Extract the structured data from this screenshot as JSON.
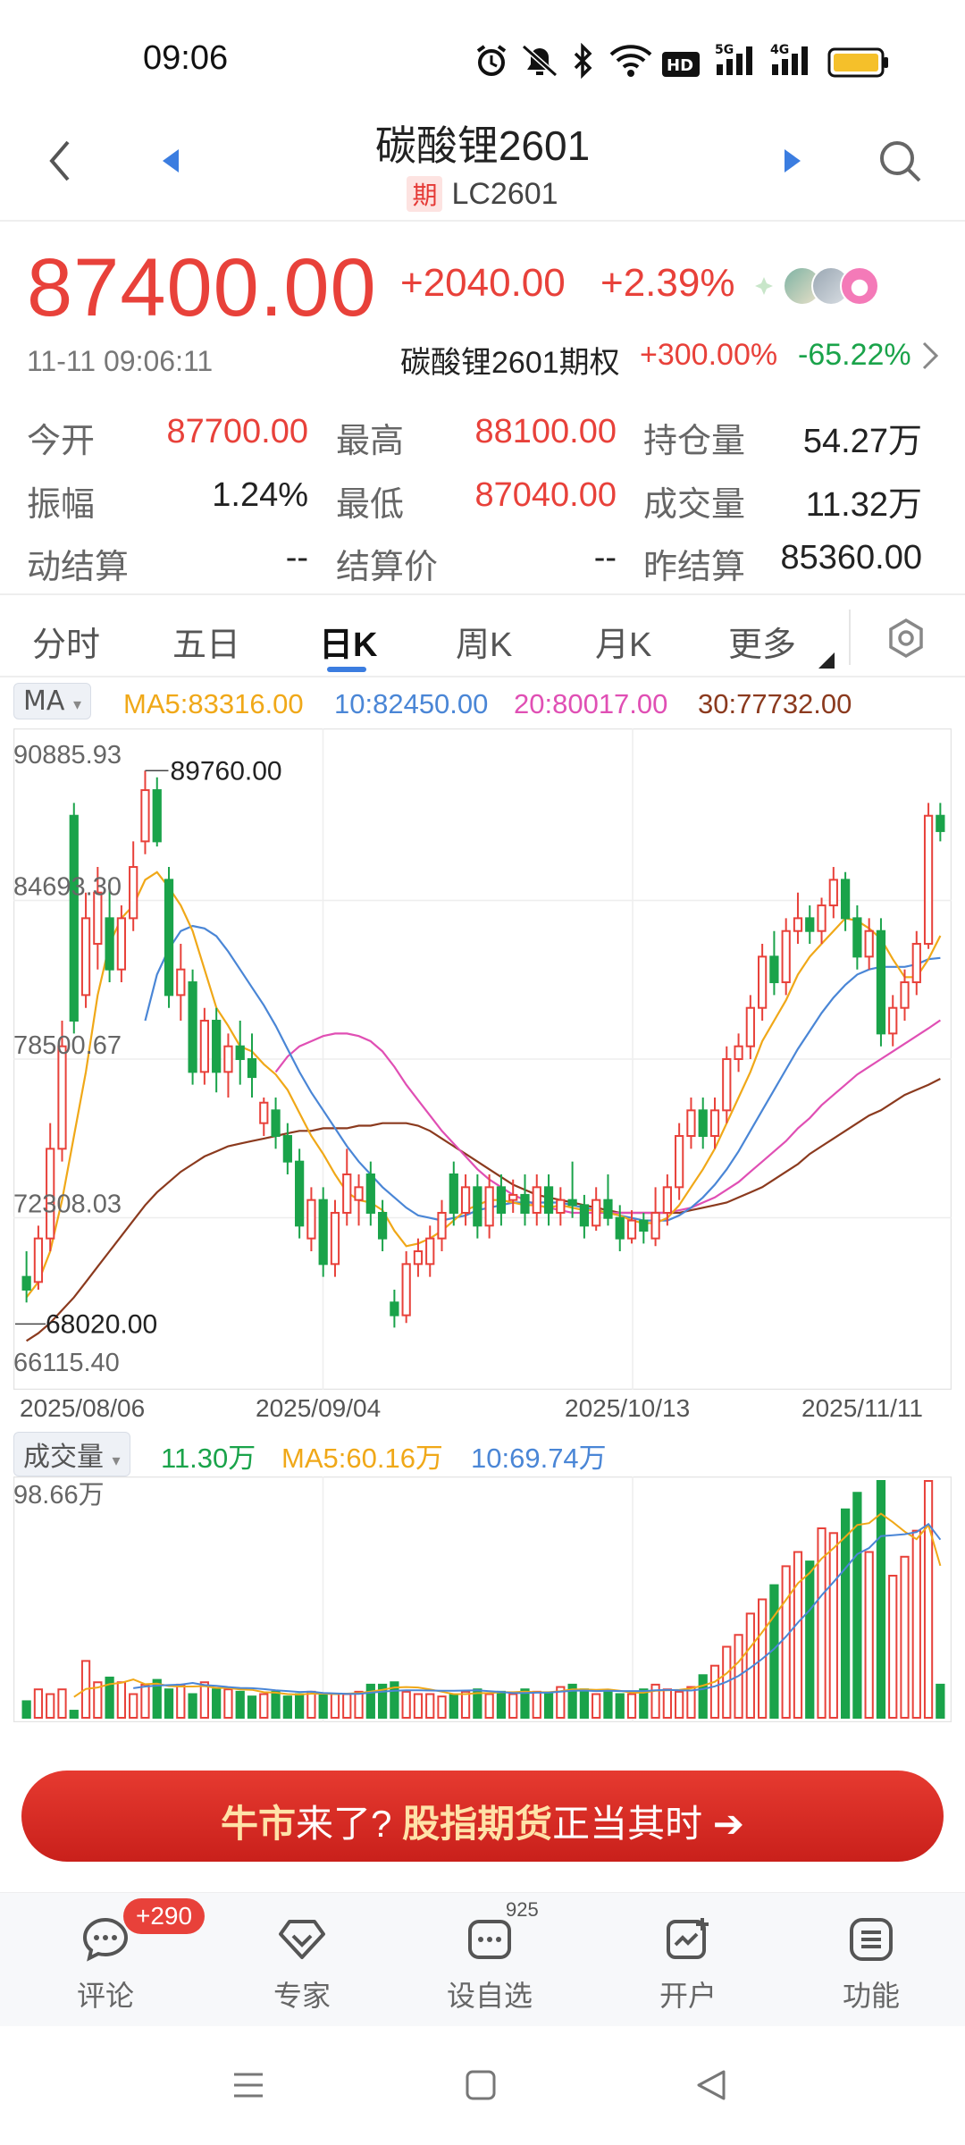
{
  "status": {
    "time": "09:06",
    "battery_color": "#f5c02a"
  },
  "header": {
    "title": "碳酸锂2601",
    "tag": "期",
    "code": "LC2601"
  },
  "quote": {
    "price": "87400.00",
    "change": "+2040.00",
    "change_pct": "+2.39%",
    "timestamp": "11-11 09:06:11",
    "option_name": "碳酸锂2601期权",
    "option_up": "+300.00%",
    "option_down": "-65.22%",
    "up_color": "#e8413a",
    "down_color": "#1aa34a"
  },
  "stats": [
    {
      "label": "今开",
      "value": "87700.00",
      "color": "red"
    },
    {
      "label": "最高",
      "value": "88100.00",
      "color": "red"
    },
    {
      "label": "持仓量",
      "value": "54.27万",
      "color": "black"
    },
    {
      "label": "振幅",
      "value": "1.24%",
      "color": "black"
    },
    {
      "label": "最低",
      "value": "87040.00",
      "color": "red"
    },
    {
      "label": "成交量",
      "value": "11.32万",
      "color": "black"
    },
    {
      "label": "动结算",
      "value": "--",
      "color": "black"
    },
    {
      "label": "结算价",
      "value": "--",
      "color": "black"
    },
    {
      "label": "昨结算",
      "value": "85360.00",
      "color": "black"
    }
  ],
  "tabs": [
    {
      "label": "分时",
      "active": false
    },
    {
      "label": "五日",
      "active": false
    },
    {
      "label": "日K",
      "active": true
    },
    {
      "label": "周K",
      "active": false
    },
    {
      "label": "月K",
      "active": false
    },
    {
      "label": "更多",
      "active": false
    }
  ],
  "ma_legend": {
    "selector": "MA",
    "ma5": "MA5:83316.00",
    "ma10": "10:82450.00",
    "ma20": "20:80017.00",
    "ma30": "30:77732.00",
    "colors": {
      "ma5": "#f0a818",
      "ma10": "#4a86d6",
      "ma20": "#e04fb4",
      "ma30": "#8b3a1e"
    }
  },
  "chart_data": {
    "type": "candlestick",
    "y_tick_labels": [
      "90885.93",
      "84693.30",
      "78500.67",
      "72308.03",
      "66115.40"
    ],
    "ylim": [
      66115.4,
      90885.93
    ],
    "x_tick_labels": [
      "2025/08/06",
      "2025/09/04",
      "2025/10/13",
      "2025/11/11"
    ],
    "annotations": [
      {
        "label": "89760.00",
        "kind": "high"
      },
      {
        "label": "68020.00",
        "kind": "low"
      }
    ],
    "candles": [
      [
        70000,
        69500,
        71000,
        69000
      ],
      [
        69800,
        71500,
        72000,
        69500
      ],
      [
        71500,
        75000,
        76000,
        71000
      ],
      [
        75000,
        79000,
        80000,
        74500
      ],
      [
        88000,
        80000,
        88500,
        79500
      ],
      [
        81000,
        84000,
        85000,
        80500
      ],
      [
        83000,
        85000,
        86000,
        82000
      ],
      [
        84000,
        82000,
        85500,
        81500
      ],
      [
        82000,
        84000,
        84500,
        81500
      ],
      [
        84000,
        86000,
        87000,
        83500
      ],
      [
        87000,
        89000,
        89760,
        86500
      ],
      [
        89000,
        87000,
        89500,
        86800
      ],
      [
        85500,
        81000,
        86000,
        80500
      ],
      [
        81000,
        82000,
        83000,
        80000
      ],
      [
        81500,
        78000,
        82000,
        77500
      ],
      [
        78000,
        80000,
        80500,
        77500
      ],
      [
        80000,
        78000,
        80500,
        77200
      ],
      [
        78000,
        79000,
        79500,
        77000
      ],
      [
        79000,
        78500,
        80000,
        77500
      ],
      [
        78500,
        77800,
        79500,
        77000
      ],
      [
        76000,
        76800,
        77000,
        75500
      ],
      [
        76500,
        75500,
        77000,
        75000
      ],
      [
        75500,
        74500,
        76000,
        74000
      ],
      [
        74500,
        72000,
        75000,
        71500
      ],
      [
        71500,
        73000,
        73500,
        71000
      ],
      [
        73000,
        70500,
        73500,
        70000
      ],
      [
        70500,
        72500,
        73000,
        70000
      ],
      [
        72500,
        74000,
        75000,
        72000
      ],
      [
        73000,
        73500,
        74000,
        72000
      ],
      [
        74000,
        72500,
        74500,
        72000
      ],
      [
        72500,
        71500,
        73000,
        71000
      ],
      [
        69000,
        68500,
        69500,
        68020
      ],
      [
        68500,
        70500,
        71000,
        68200
      ],
      [
        70500,
        71000,
        71500,
        70000
      ],
      [
        70500,
        71500,
        72000,
        70000
      ],
      [
        71500,
        72500,
        73000,
        71000
      ],
      [
        74000,
        72500,
        74500,
        72000
      ],
      [
        72500,
        73500,
        74000,
        72000
      ],
      [
        73500,
        72000,
        74000,
        71500
      ],
      [
        72000,
        73500,
        74000,
        71500
      ],
      [
        73500,
        72500,
        74000,
        72000
      ],
      [
        73000,
        73200,
        73800,
        72500
      ],
      [
        73200,
        72500,
        74000,
        72000
      ],
      [
        72500,
        73500,
        74000,
        72000
      ],
      [
        73500,
        72500,
        74000,
        72000
      ],
      [
        72500,
        73000,
        73500,
        72000
      ],
      [
        73000,
        72800,
        74500,
        72300
      ],
      [
        72800,
        72000,
        73200,
        71500
      ],
      [
        72000,
        73000,
        73500,
        71800
      ],
      [
        73000,
        72300,
        74000,
        72000
      ],
      [
        72300,
        71500,
        72800,
        71000
      ],
      [
        71500,
        72200,
        72600,
        71300
      ],
      [
        72200,
        71800,
        72500,
        71300
      ],
      [
        71500,
        72500,
        73500,
        71200
      ],
      [
        72500,
        73500,
        74000,
        72000
      ],
      [
        73500,
        75500,
        76000,
        73000
      ],
      [
        75500,
        76500,
        77000,
        75000
      ],
      [
        76500,
        75500,
        77000,
        75000
      ],
      [
        75500,
        76500,
        77000,
        75000
      ],
      [
        76500,
        78500,
        79000,
        76000
      ],
      [
        78500,
        79000,
        79500,
        78000
      ],
      [
        79000,
        80500,
        81000,
        78500
      ],
      [
        80500,
        82500,
        83000,
        80000
      ],
      [
        82500,
        81500,
        83500,
        81000
      ],
      [
        81500,
        83500,
        84000,
        81000
      ],
      [
        83500,
        84000,
        85000,
        83000
      ],
      [
        84000,
        83500,
        84500,
        83000
      ],
      [
        83500,
        84500,
        84800,
        83000
      ],
      [
        84500,
        85500,
        86000,
        84000
      ],
      [
        85500,
        84000,
        85800,
        83500
      ],
      [
        84000,
        82500,
        84500,
        82000
      ],
      [
        82500,
        83500,
        84000,
        82000
      ],
      [
        83500,
        79500,
        84000,
        79000
      ],
      [
        79500,
        80500,
        81000,
        79000
      ],
      [
        80500,
        81500,
        82000,
        80000
      ],
      [
        81500,
        83000,
        83500,
        81000
      ],
      [
        83000,
        88000,
        88500,
        82800
      ],
      [
        88000,
        87400,
        88500,
        87000
      ]
    ],
    "ma5": [
      69200,
      69800,
      71000,
      73000,
      75500,
      78000,
      81000,
      83000,
      84000,
      84500,
      85500,
      85800,
      85200,
      84500,
      83500,
      82000,
      80500,
      79800,
      79000,
      78800,
      78300,
      77900,
      77300,
      76400,
      75500,
      74800,
      74000,
      73300,
      73000,
      72900,
      72600,
      71800,
      71200,
      71300,
      71500,
      71800,
      72200,
      72600,
      72800,
      73000,
      73000,
      72900,
      72800,
      72800,
      72700,
      72800,
      72700,
      72600,
      72600,
      72500,
      72400,
      72200,
      72100,
      72100,
      72300,
      72800,
      73500,
      74200,
      75000,
      76000,
      77000,
      78000,
      79200,
      80000,
      80800,
      81800,
      82500,
      83000,
      83500,
      84000,
      83900,
      83600,
      83200,
      82400,
      81700,
      81700,
      82400,
      83316
    ],
    "ma10": [
      null,
      null,
      null,
      null,
      null,
      null,
      null,
      null,
      null,
      null,
      80000,
      81800,
      82800,
      83500,
      83700,
      83600,
      83300,
      82700,
      82000,
      81300,
      80600,
      79800,
      78900,
      78000,
      77200,
      76500,
      75800,
      75100,
      74500,
      74000,
      73500,
      73100,
      72700,
      72400,
      72300,
      72200,
      72300,
      72400,
      72600,
      72700,
      72800,
      72900,
      72900,
      72900,
      72900,
      72900,
      72800,
      72700,
      72600,
      72500,
      72400,
      72300,
      72200,
      72200,
      72200,
      72400,
      72700,
      73100,
      73600,
      74200,
      74900,
      75700,
      76500,
      77300,
      78100,
      78900,
      79600,
      80300,
      80900,
      81400,
      81800,
      82000,
      82100,
      82100,
      82100,
      82200,
      82400,
      82450
    ],
    "ma20": [
      null,
      null,
      null,
      null,
      null,
      null,
      null,
      null,
      null,
      null,
      null,
      null,
      null,
      null,
      null,
      null,
      null,
      null,
      null,
      null,
      null,
      78000,
      78600,
      79000,
      79200,
      79400,
      79500,
      79500,
      79400,
      79200,
      78800,
      78200,
      77500,
      76900,
      76300,
      75700,
      75200,
      74700,
      74200,
      73800,
      73500,
      73200,
      73000,
      72800,
      72700,
      72600,
      72500,
      72500,
      72500,
      72500,
      72500,
      72500,
      72500,
      72500,
      72500,
      72600,
      72700,
      72900,
      73100,
      73400,
      73700,
      74100,
      74500,
      74900,
      75300,
      75800,
      76200,
      76700,
      77100,
      77500,
      77900,
      78200,
      78500,
      78800,
      79100,
      79400,
      79700,
      80017
    ],
    "ma30": [
      67500,
      67800,
      68200,
      68700,
      69200,
      69800,
      70400,
      71000,
      71600,
      72200,
      72800,
      73300,
      73700,
      74100,
      74400,
      74700,
      74900,
      75100,
      75200,
      75300,
      75400,
      75500,
      75600,
      75700,
      75700,
      75800,
      75800,
      75800,
      75900,
      75900,
      76000,
      76000,
      76000,
      75900,
      75700,
      75400,
      75100,
      74800,
      74500,
      74200,
      73900,
      73600,
      73400,
      73200,
      73100,
      73000,
      72900,
      72800,
      72700,
      72600,
      72500,
      72500,
      72500,
      72500,
      72500,
      72500,
      72600,
      72700,
      72800,
      72900,
      73100,
      73300,
      73500,
      73800,
      74100,
      74400,
      74800,
      75100,
      75400,
      75700,
      76000,
      76300,
      76500,
      76800,
      77100,
      77300,
      77500,
      77732
    ]
  },
  "volume": {
    "selector": "成交量",
    "current": "11.30万",
    "ma5": "MA5:60.16万",
    "ma10": "10:69.74万",
    "max_label": "98.66万",
    "values": [
      7,
      12,
      10,
      12,
      3,
      24,
      15,
      17,
      15,
      10,
      14,
      16,
      12,
      14,
      10,
      15,
      12,
      12,
      11,
      9,
      10,
      11,
      9,
      10,
      11,
      10,
      10,
      10,
      11,
      14,
      14,
      15,
      11,
      10,
      10,
      9,
      10,
      11,
      12,
      10,
      11,
      10,
      12,
      11,
      10,
      13,
      14,
      12,
      10,
      11,
      10,
      10,
      12,
      14,
      12,
      11,
      13,
      18,
      22,
      30,
      35,
      44,
      50,
      56,
      64,
      70,
      66,
      80,
      78,
      88,
      95,
      70,
      100,
      60,
      68,
      79,
      100,
      14
    ]
  },
  "banner": {
    "part1": "牛市",
    "part2": "来了?",
    "part3": "股指期货",
    "part4": "正当其时",
    "arrow": "➔"
  },
  "toolbar": [
    {
      "label": "评论",
      "icon": "comment-icon"
    },
    {
      "label": "专家",
      "icon": "expert-icon"
    },
    {
      "label": "设自选",
      "icon": "favorite-add-icon"
    },
    {
      "label": "开户",
      "icon": "open-account-icon"
    },
    {
      "label": "功能",
      "icon": "menu-icon"
    }
  ],
  "badges": {
    "comments": "+290",
    "watchlist": "925"
  }
}
